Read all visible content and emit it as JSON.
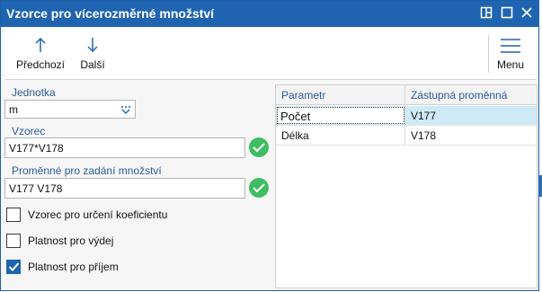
{
  "window": {
    "title": "Vzorce pro vícerozměrné množství"
  },
  "toolbar": {
    "prev_label": "Předchozí",
    "next_label": "Další",
    "menu_label": "Menu"
  },
  "form": {
    "unit": {
      "label": "Jednotka",
      "value": "m"
    },
    "formula": {
      "label": "Vzorec",
      "value": "V177*V178"
    },
    "variables": {
      "label": "Proměnné pro zadání množství",
      "value": "V177 V178"
    },
    "checkboxes": [
      {
        "label": "Vzorec pro určení koeficientu",
        "checked": false
      },
      {
        "label": "Platnost pro výdej",
        "checked": false
      },
      {
        "label": "Platnost pro příjem",
        "checked": true
      }
    ]
  },
  "grid": {
    "columns": [
      "Parametr",
      "Zástupná proměnná"
    ],
    "rows": [
      {
        "param": "Počet",
        "var": "V177",
        "selected": true
      },
      {
        "param": "Délka",
        "var": "V178",
        "selected": false
      }
    ]
  },
  "colors": {
    "titlebar": "#1f64b0",
    "accent_label": "#2a5b99",
    "ok": "#3fbd62",
    "selected_row": "#cfeaf7"
  }
}
